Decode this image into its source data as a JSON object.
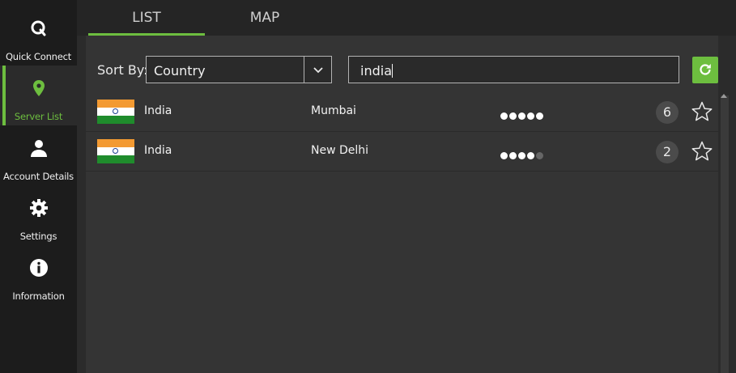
{
  "sidebar": {
    "items": [
      {
        "label": "Quick Connect",
        "icon": "quick-connect-icon"
      },
      {
        "label": "Server List",
        "icon": "location-pin-icon"
      },
      {
        "label": "Account Details",
        "icon": "user-icon"
      },
      {
        "label": "Settings",
        "icon": "gear-icon"
      },
      {
        "label": "Information",
        "icon": "info-icon"
      }
    ],
    "active_index": 1
  },
  "tabs": [
    {
      "label": "LIST"
    },
    {
      "label": "MAP"
    }
  ],
  "toolbar": {
    "sort_label": "Sort By:",
    "sort_value": "Country",
    "search_value": "india"
  },
  "servers": [
    {
      "country": "India",
      "city": "Mumbai",
      "signal": 5,
      "signal_max": 5,
      "count": "6"
    },
    {
      "country": "India",
      "city": "New Delhi",
      "signal": 4,
      "signal_max": 5,
      "count": "2"
    }
  ],
  "colors": {
    "accent": "#6dbe3f",
    "sidebar_bg": "#1c1c1c",
    "panel_bg": "#343434"
  }
}
